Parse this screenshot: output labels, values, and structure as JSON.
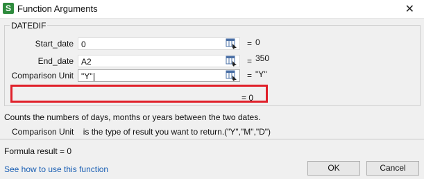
{
  "window": {
    "title": "Function Arguments",
    "app_icon_letter": "S",
    "close_glyph": "✕"
  },
  "function": {
    "name": "DATEDIF",
    "args": [
      {
        "label": "Start_date",
        "value": "0",
        "result": "0"
      },
      {
        "label": "End_date",
        "value": "A2",
        "result": "350"
      },
      {
        "label": "Comparison Unit",
        "value": "\"Y\"",
        "result": "\"Y\""
      }
    ],
    "equals": "=",
    "overall_result": "0",
    "description": "Counts the numbers of days, months or years between the two dates.",
    "arg_name": "Comparison Unit",
    "arg_description": "is the type of result you want to return.(\"Y\",\"M\",\"D\")"
  },
  "footer": {
    "formula_result_label": "Formula result",
    "formula_result_value": "0",
    "help_link": "See how to use this function",
    "ok_label": "OK",
    "cancel_label": "Cancel"
  },
  "colors": {
    "highlight": "#e0202a",
    "link": "#1a5fb4",
    "app_icon": "#2e8b3d"
  }
}
